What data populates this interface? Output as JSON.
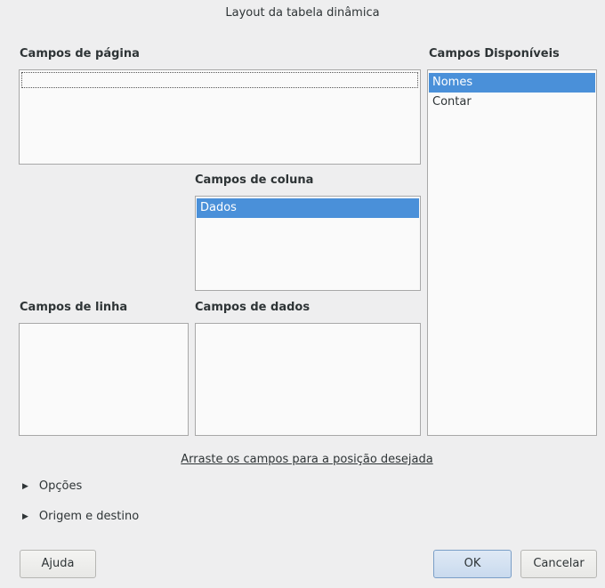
{
  "dialog": {
    "title": "Layout da tabela dinâmica"
  },
  "page_fields": {
    "label": "Campos de página",
    "items": []
  },
  "available_fields": {
    "label": "Campos Disponíveis",
    "items": [
      {
        "label": "Nomes",
        "selected": true
      },
      {
        "label": "Contar",
        "selected": false
      }
    ]
  },
  "column_fields": {
    "label": "Campos de coluna",
    "items": [
      {
        "label": "Dados",
        "selected": true
      }
    ]
  },
  "row_fields": {
    "label": "Campos de linha",
    "items": []
  },
  "data_fields": {
    "label": "Campos de dados",
    "items": []
  },
  "hint": "Arraste os campos para a posição desejada",
  "expanders": {
    "options": "Opções",
    "source_destination": "Origem e destino"
  },
  "buttons": {
    "help": "Ajuda",
    "ok": "OK",
    "cancel": "Cancelar"
  },
  "colors": {
    "selection": "#4a90d9",
    "background": "#eeeeef"
  }
}
